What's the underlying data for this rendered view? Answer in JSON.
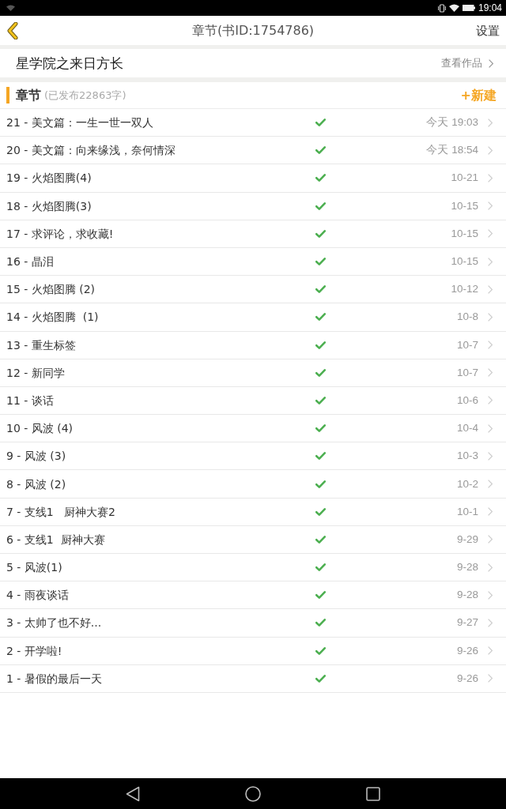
{
  "status_bar": {
    "time": "19:04"
  },
  "nav": {
    "title": "章节(书ID:1754786)",
    "action": "设置"
  },
  "book": {
    "title": "星学院之来日方长",
    "link": "查看作品"
  },
  "section": {
    "title": "章节",
    "subtitle": "(已发布22863字)",
    "action": "+新建"
  },
  "chapters": [
    {
      "title": "21 - 美文篇：一生一世一双人",
      "published": true,
      "date": "今天 19:03"
    },
    {
      "title": "20 - 美文篇：向来缘浅，奈何情深",
      "published": true,
      "date": "今天 18:54"
    },
    {
      "title": "19 - 火焰图腾(4)",
      "published": true,
      "date": "10-21"
    },
    {
      "title": "18 - 火焰图腾(3)",
      "published": true,
      "date": "10-15"
    },
    {
      "title": "17 - 求评论，求收藏!",
      "published": true,
      "date": "10-15"
    },
    {
      "title": "16 - 晶泪",
      "published": true,
      "date": "10-15"
    },
    {
      "title": "15 - 火焰图腾 (2)",
      "published": true,
      "date": "10-12"
    },
    {
      "title": "14 - 火焰图腾  (1)",
      "published": true,
      "date": "10-8"
    },
    {
      "title": "13 - 重生标签",
      "published": true,
      "date": "10-7"
    },
    {
      "title": "12 - 新同学",
      "published": true,
      "date": "10-7"
    },
    {
      "title": "11 - 谈话",
      "published": true,
      "date": "10-6"
    },
    {
      "title": "10 - 风波 (4)",
      "published": true,
      "date": "10-4"
    },
    {
      "title": "9 - 风波 (3)",
      "published": true,
      "date": "10-3"
    },
    {
      "title": "8 - 风波 (2)",
      "published": true,
      "date": "10-2"
    },
    {
      "title": "7 - 支线1   厨神大赛2",
      "published": true,
      "date": "10-1"
    },
    {
      "title": "6 - 支线1  厨神大赛",
      "published": true,
      "date": "9-29"
    },
    {
      "title": "5 - 风波(1)",
      "published": true,
      "date": "9-28"
    },
    {
      "title": "4 - 雨夜谈话",
      "published": true,
      "date": "9-28"
    },
    {
      "title": "3 - 太帅了也不好...",
      "published": true,
      "date": "9-27"
    },
    {
      "title": "2 - 开学啦!",
      "published": true,
      "date": "9-26"
    },
    {
      "title": "1 - 暑假的最后一天",
      "published": true,
      "date": "9-26"
    }
  ]
}
